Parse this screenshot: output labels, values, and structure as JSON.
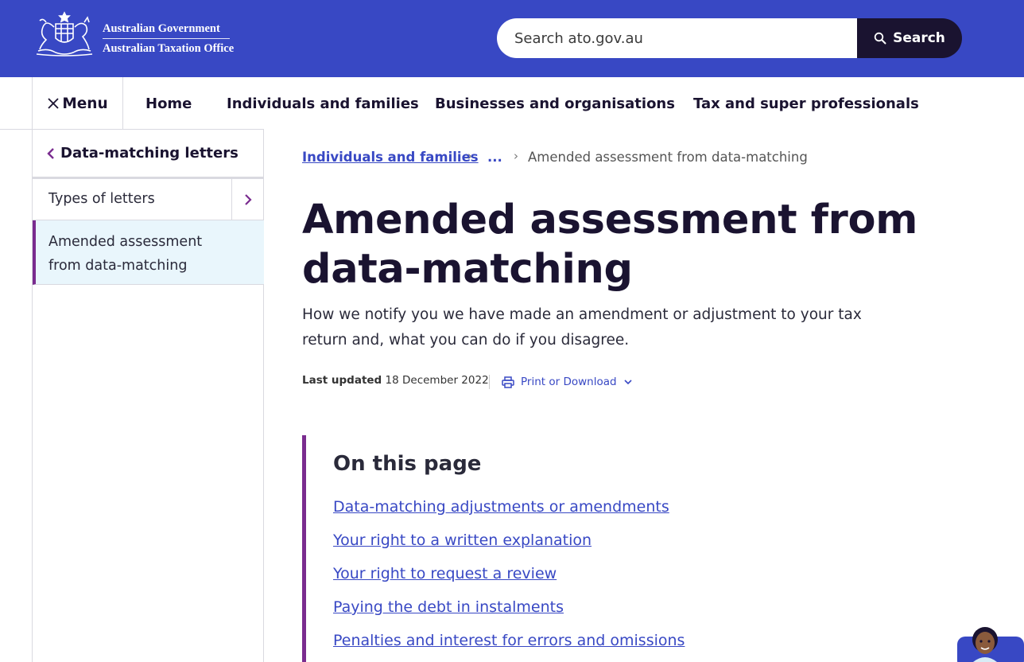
{
  "header": {
    "logo_line1": "Australian Government",
    "logo_line2": "Australian Taxation Office",
    "search_placeholder": "Search ato.gov.au",
    "search_button": "Search"
  },
  "nav": {
    "menu_label": "Menu",
    "items": [
      "Home",
      "Individuals and families",
      "Businesses and organisations",
      "Tax and super professionals"
    ]
  },
  "sidebar": {
    "back_label": "Data-matching letters",
    "items": [
      {
        "label": "Types of letters"
      },
      {
        "label": "Amended assessment from data-matching"
      }
    ]
  },
  "breadcrumb": {
    "items": [
      "Individuals and families",
      "...",
      "Amended assessment from data-matching"
    ]
  },
  "page": {
    "title": "Amended assessment from data-matching",
    "lead": "How we notify you we have made an amendment or adjustment to your tax return and, what you can do if you disagree.",
    "last_updated_label": "Last updated",
    "last_updated_date": "18 December 2022",
    "print_label": "Print or Download"
  },
  "toc": {
    "title": "On this page",
    "links": [
      "Data-matching adjustments or amendments",
      "Your right to a written explanation",
      "Your right to request a review",
      "Paying the debt in instalments",
      "Penalties and interest for errors and omissions"
    ]
  },
  "colors": {
    "header_blue": "#3848c4",
    "dark_navy": "#1a1330",
    "accent_purple": "#7a2c8f",
    "link_blue": "#3848c4",
    "active_bg": "#e9f6fc"
  }
}
